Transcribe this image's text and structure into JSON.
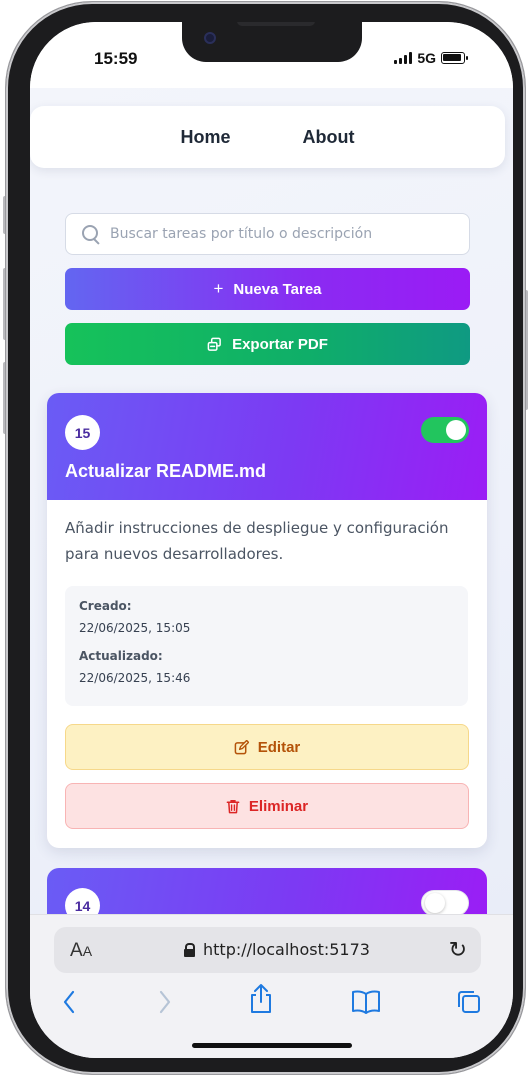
{
  "status_bar": {
    "time": "15:59",
    "network": "5G"
  },
  "navbar": {
    "links": [
      "Home",
      "About"
    ]
  },
  "search": {
    "placeholder": "Buscar tareas por título o descripción",
    "value": ""
  },
  "actions": {
    "new_task_label": "Nueva Tarea",
    "new_task_icon": "+",
    "export_pdf_label": "Exportar PDF",
    "export_pdf_icon": "document-export-icon"
  },
  "tasks": [
    {
      "id": "15",
      "title": "Actualizar README.md",
      "description": "Añadir instrucciones de despliegue y configuración para nuevos desarrolladores.",
      "completed": true,
      "created_label": "Creado:",
      "created_value": "22/06/2025, 15:05",
      "updated_label": "Actualizado:",
      "updated_value": "22/06/2025, 15:46",
      "edit_label": "Editar",
      "delete_label": "Eliminar"
    },
    {
      "id": "14",
      "completed": false
    }
  ],
  "browser": {
    "aa_label": "AA",
    "url": "http://localhost:5173"
  },
  "colors": {
    "primary_gradient_start": "#6366f1",
    "primary_gradient_end": "#9b1bf5",
    "pdf_gradient_start": "#16c25a",
    "pdf_gradient_end": "#0f9a82",
    "toggle_on": "#22c55e",
    "edit_bg": "#fdf1c3",
    "edit_text": "#b45309",
    "delete_bg": "#fde2e2",
    "delete_text": "#dc2626",
    "safari_blue": "#1f7ae0"
  }
}
